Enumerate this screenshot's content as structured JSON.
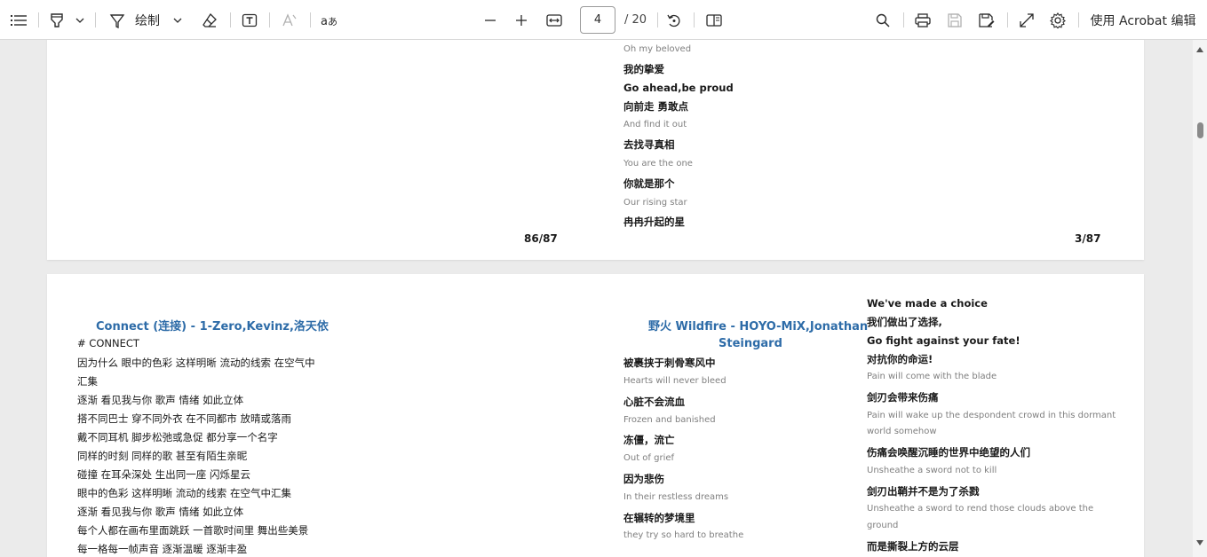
{
  "toolbar": {
    "draw_label": "绘制",
    "page_current": "4",
    "page_total": "/ 20",
    "acrobat_label": "使用 Acrobat 编辑",
    "icons": [
      "list-icon",
      "highlighter-icon",
      "chevron-down-icon",
      "pen-icon",
      "eraser-icon",
      "text-box-icon",
      "read-aloud-icon",
      "translate-icon",
      "zoom-out-icon",
      "zoom-in-icon",
      "fit-width-icon",
      "rotate-icon",
      "two-page-icon",
      "search-icon",
      "print-icon",
      "save-icon",
      "save-as-icon",
      "fullscreen-icon",
      "settings-icon"
    ]
  },
  "page1": {
    "lines": [
      {
        "text": "Oh my beloved",
        "style": "en"
      },
      {
        "text": "我的挚爱",
        "style": "cn"
      },
      {
        "text": "Go ahead,be proud",
        "style": "bk"
      },
      {
        "text": "向前走 勇敢点",
        "style": "cn"
      },
      {
        "text": "And find it out",
        "style": "en"
      },
      {
        "text": "去找寻真相",
        "style": "cn"
      },
      {
        "text": "You are the one",
        "style": "en"
      },
      {
        "text": "你就是那个",
        "style": "cn"
      },
      {
        "text": "Our rising star",
        "style": "en"
      },
      {
        "text": "冉冉升起的星",
        "style": "cn"
      }
    ],
    "page_left": "86/87",
    "page_right": "3/87"
  },
  "page2": {
    "left_title": "Connect (连接) - 1-Zero,Kevinz,洛天依",
    "left_lines": [
      "# CONNECT",
      "因为什么 眼中的色彩 这样明晰 流动的线索 在空气中",
      "汇集",
      "逐渐 看见我与你 歌声 情绪 如此立体",
      "搭不同巴士 穿不同外衣 在不同都市 放晴或落雨",
      "戴不同耳机 脚步松弛或急促 都分享一个名字",
      "同样的时刻 同样的歌 甚至有陌生亲昵",
      "碰撞 在耳朵深处 生出同一座 闪烁星云",
      "眼中的色彩 这样明晰 流动的线索 在空气中汇集",
      "逐渐 看见我与你 歌声 情绪 如此立体",
      "每个人都在画布里面跳跃 一首歌时间里 舞出些美景",
      "每一格每一帧声音 逐渐温暖 逐渐丰盈"
    ],
    "mid_title_1": "野火 Wildfire - HOYO-MiX,Jonathan",
    "mid_title_2": "Steingard",
    "mid_lines": [
      {
        "text": "被裹挟于刺骨寒风中",
        "style": "cn"
      },
      {
        "text": "Hearts will never bleed",
        "style": "en"
      },
      {
        "text": "心脏不会流血",
        "style": "cn"
      },
      {
        "text": "Frozen and banished",
        "style": "en"
      },
      {
        "text": "冻僵，流亡",
        "style": "cn"
      },
      {
        "text": "Out of grief",
        "style": "en"
      },
      {
        "text": "因为悲伤",
        "style": "cn"
      },
      {
        "text": "In their restless dreams",
        "style": "en"
      },
      {
        "text": "在辗转的梦境里",
        "style": "cn"
      },
      {
        "text": "they try so hard to breathe",
        "style": "en"
      }
    ],
    "right_lines": [
      {
        "text": "We've made a choice",
        "style": "bk"
      },
      {
        "text": "我们做出了选择,",
        "style": "cn"
      },
      {
        "text": "Go fight against your fate!",
        "style": "bk"
      },
      {
        "text": "对抗你的命运!",
        "style": "cn"
      },
      {
        "text": "Pain will come with the blade",
        "style": "en"
      },
      {
        "text": "剑刃会带来伤痛",
        "style": "cn"
      },
      {
        "text": "Pain will wake up the despondent crowd in this dormant",
        "style": "en"
      },
      {
        "text": "world somehow",
        "style": "en"
      },
      {
        "text": "伤痛会唤醒沉睡的世界中绝望的人们",
        "style": "cn"
      },
      {
        "text": "Unsheathe a sword not to kill",
        "style": "en"
      },
      {
        "text": "剑刃出鞘并不是为了杀戮",
        "style": "cn"
      },
      {
        "text": "Unsheathe a sword to rend those clouds above the",
        "style": "en"
      },
      {
        "text": "ground",
        "style": "en"
      },
      {
        "text": "而是撕裂上方的云层",
        "style": "cn"
      }
    ]
  }
}
